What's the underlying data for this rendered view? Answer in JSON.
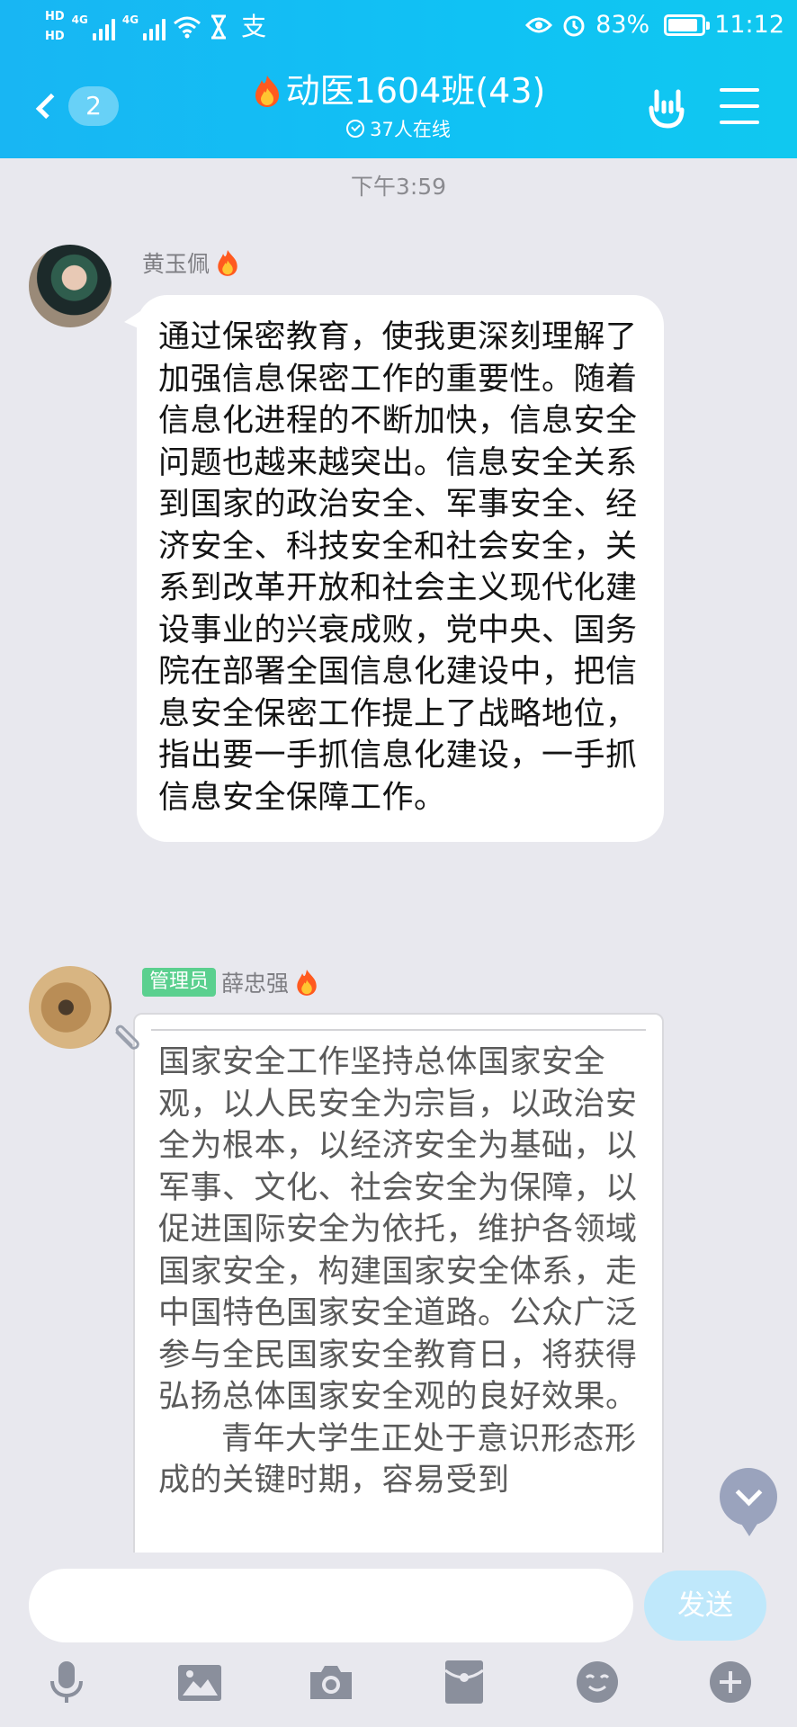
{
  "status_bar": {
    "hd1": "HD",
    "hd2": "HD",
    "sim1_tag": "4G",
    "sim2_tag": "4G",
    "battery": "83%",
    "time": "11:12"
  },
  "header": {
    "unread_count": "2",
    "group_name": "动医1604班(43)",
    "online_count": "37人在线"
  },
  "chat": {
    "timestamp": "下午3:59",
    "messages": [
      {
        "sender": "黄玉佩",
        "text": "通过保密教育，使我更深刻理解了加强信息保密工作的重要性。随着信息化进程的不断加快，信息安全问题也越来越突出。信息安全关系到国家的政治安全、军事安全、经济安全、科技安全和社会安全，关系到改革开放和社会主义现代化建设事业的兴衰成败，党中央、国务院在部署全国信息化建设中，把信息安全保密工作提上了战略地位，指出要一手抓信息化建设，一手抓信息安全保障工作。"
      },
      {
        "badge": "管理员",
        "sender": "薛忠强",
        "paragraph1": "国家安全工作坚持总体国家安全观，以人民安全为宗旨，以政治安全为根本，以经济安全为基础，以军事、文化、社会安全为保障，以促进国际安全为依托，维护各领域国家安全，构建国家安全体系，走中国特色国家安全道路。公众广泛参与全民国家安全教育日，将获得弘扬总体国家安全观的良好效果。",
        "paragraph2": "青年大学生正处于意识形态形成的关键时期，容易受到"
      }
    ]
  },
  "input": {
    "placeholder": "",
    "send_label": "发送"
  },
  "toolbar": {
    "icons": [
      "microphone-icon",
      "image-icon",
      "camera-icon",
      "red-packet-icon",
      "emoji-icon",
      "plus-icon"
    ]
  },
  "colors": {
    "header_start": "#18b6f3",
    "header_end": "#10c8f0",
    "background": "#e8e8ee",
    "admin_badge": "#5bd08f",
    "send_button": "#bfe8fb"
  }
}
